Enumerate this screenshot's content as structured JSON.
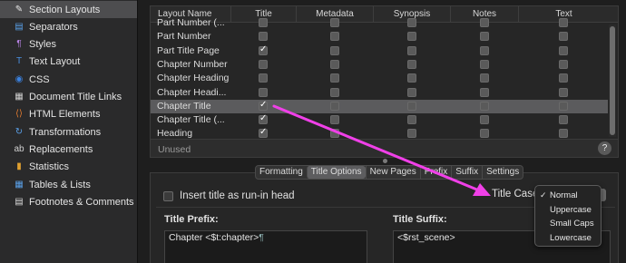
{
  "sidebar": {
    "items": [
      {
        "label": "Section Layouts",
        "icon": "section-layouts-icon",
        "glyph": "✎",
        "color": "#e8e8e8",
        "selected": true
      },
      {
        "label": "Separators",
        "icon": "separators-icon",
        "glyph": "▤",
        "color": "#5aa0e8"
      },
      {
        "label": "Styles",
        "icon": "styles-icon",
        "glyph": "¶",
        "color": "#b480e0"
      },
      {
        "label": "Text Layout",
        "icon": "text-layout-icon",
        "glyph": "T",
        "color": "#4a8fe0"
      },
      {
        "label": "CSS",
        "icon": "css-icon",
        "glyph": "◉",
        "color": "#3b82e0"
      },
      {
        "label": "Document Title Links",
        "icon": "document-title-links-icon",
        "glyph": "▦",
        "color": "#cfcfcf"
      },
      {
        "label": "HTML Elements",
        "icon": "html-elements-icon",
        "glyph": "⟨⟩",
        "color": "#e07a30"
      },
      {
        "label": "Transformations",
        "icon": "transformations-icon",
        "glyph": "↻",
        "color": "#5aa0e8"
      },
      {
        "label": "Replacements",
        "icon": "replacements-icon",
        "glyph": "ab",
        "color": "#d0d0d0"
      },
      {
        "label": "Statistics",
        "icon": "statistics-icon",
        "glyph": "▮",
        "color": "#e0a030"
      },
      {
        "label": "Tables & Lists",
        "icon": "tables-lists-icon",
        "glyph": "▦",
        "color": "#5aa0e8"
      },
      {
        "label": "Footnotes & Comments",
        "icon": "footnotes-comments-icon",
        "glyph": "▤",
        "color": "#d8d8d8"
      }
    ]
  },
  "table": {
    "columns": [
      "Layout Name",
      "Title",
      "Metadata",
      "Synopsis",
      "Notes",
      "Text"
    ],
    "rows": [
      {
        "name": "Part Number (...",
        "checks": [
          false,
          false,
          false,
          false,
          false
        ]
      },
      {
        "name": "Part Number",
        "checks": [
          false,
          false,
          false,
          false,
          false
        ]
      },
      {
        "name": "Part Title Page",
        "checks": [
          true,
          false,
          false,
          false,
          false
        ]
      },
      {
        "name": "Chapter Number",
        "checks": [
          false,
          false,
          false,
          false,
          false
        ]
      },
      {
        "name": "Chapter Heading",
        "checks": [
          false,
          false,
          false,
          false,
          false
        ]
      },
      {
        "name": "Chapter Headi...",
        "checks": [
          false,
          false,
          false,
          false,
          false
        ]
      },
      {
        "name": "Chapter Title",
        "checks": [
          true,
          false,
          false,
          false,
          false
        ],
        "selected": true
      },
      {
        "name": "Chapter Title (...",
        "checks": [
          true,
          false,
          false,
          false,
          false
        ]
      },
      {
        "name": "Heading",
        "checks": [
          true,
          false,
          false,
          false,
          false
        ]
      }
    ],
    "unused_label": "Unused",
    "help_label": "?"
  },
  "tabs": {
    "items": [
      "Formatting",
      "Title Options",
      "New Pages",
      "Prefix",
      "Suffix",
      "Settings"
    ],
    "selected": "Title Options"
  },
  "options": {
    "runin_label": "Insert title as run-in head",
    "runin_checked": false,
    "title_case_label": "Title Case:",
    "title_prefix_label": "Title Prefix:",
    "title_suffix_label": "Title Suffix:",
    "title_prefix_value": "Chapter <$t:chapter>",
    "title_prefix_mark": "¶",
    "title_suffix_value": "<$rst_scene>"
  },
  "title_case_menu": {
    "options": [
      "Normal",
      "Uppercase",
      "Small Caps",
      "Lowercase"
    ],
    "selected": "Normal",
    "check_glyph": "✓"
  },
  "annotation": {
    "arrow_color": "#f040e8"
  }
}
